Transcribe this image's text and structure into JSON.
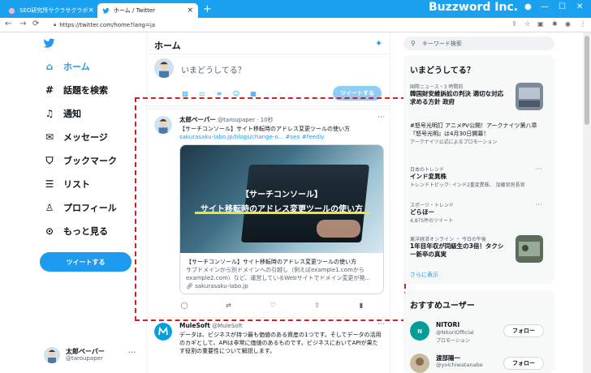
{
  "browser": {
    "tabs": [
      {
        "label": "SEO研究所サクラサクラボ",
        "active": false
      },
      {
        "label": "ホーム / Twitter",
        "active": true
      }
    ],
    "new_tab": "+",
    "brand": "Buzzword Inc.",
    "url": "https://twitter.com/home?lang=ja",
    "window_controls": [
      "—",
      "☐",
      "✕"
    ]
  },
  "sidebar": {
    "items": [
      {
        "label": "ホーム",
        "icon": "home-icon",
        "active": true
      },
      {
        "label": "話題を検索",
        "icon": "hashtag-icon",
        "active": false
      },
      {
        "label": "通知",
        "icon": "bell-icon",
        "active": false
      },
      {
        "label": "メッセージ",
        "icon": "mail-icon",
        "active": false
      },
      {
        "label": "ブックマーク",
        "icon": "bookmark-icon",
        "active": false
      },
      {
        "label": "リスト",
        "icon": "list-icon",
        "active": false
      },
      {
        "label": "プロフィール",
        "icon": "person-icon",
        "active": false
      },
      {
        "label": "もっと見る",
        "icon": "more-circle-icon",
        "active": false
      }
    ],
    "tweet_button": "ツイートする",
    "account": {
      "name": "太郎ペーパー",
      "handle": "@taroupaper",
      "more": "···"
    }
  },
  "main": {
    "title": "ホーム",
    "compose": {
      "placeholder": "いまどうしてる？",
      "button": "ツイートする"
    },
    "tweets": [
      {
        "name": "太郎ペーパー",
        "handle": "@taroupaper",
        "time": "10秒",
        "text": "【サーチコンソール】サイト移転時のアドレス変更ツールの使い方",
        "link": "sakurasaku-labo.jp/blogs/change-o...",
        "hashtags": "#seo #feedly",
        "card": {
          "title_line1": "【サーチコンソール】",
          "title_line2": "サイト移転時のアドレス変更ツールの使い方",
          "desc_title": "【サーチコンソール】サイト移転時のアドレス変更ツールの使い方",
          "desc_body": "サブドメインから別ドメインへの引越し（例えばexample1.comからexample2.com）など、運営しているWebサイトでドメイン変更が発...",
          "domain": "sakurasaku-labo.jp"
        }
      },
      {
        "name": "MuleSoft",
        "handle": "@MuleSoft",
        "text": "データは、ビジネスが持つ最も価値のある資産の1つです。そしてデータの活用のカギとして、APIは非常に価値のあるものです。ビジネスにおいてAPIが果たす役割の重要性について解説します。"
      }
    ]
  },
  "right": {
    "search_placeholder": "キーワード検索",
    "trends_title": "いまどうしてる？",
    "trends": [
      {
        "category": "国際ニュース・3 時間前",
        "name": "韓国財安維訴訟の判決 適切な対応求める方針 政府",
        "sub": "",
        "has_thumb": true
      },
      {
        "category": "",
        "name": "#怒号光明訂 アニメPV公開！アークナイツ第八章『怒号光明』は4月30日開幕！",
        "sub": "アークナイツ公式によるプロモーション",
        "has_thumb": false
      },
      {
        "category": "日本のトレンド",
        "name": "インド変異株",
        "sub": "トレンドトピック: インド2重変異株、 加藤官房長官",
        "has_thumb": false
      },
      {
        "category": "スポーツ・トレンド",
        "name": "どらほー",
        "sub": "4,875件のツイート",
        "has_thumb": false
      },
      {
        "category": "東洋経済オンライン ・ 今日の午後",
        "name": "1年目年収が同級生の3倍！タクシー新卒の真実",
        "sub": "",
        "has_thumb": true
      }
    ],
    "show_more": "さらに表示",
    "follow_title": "おすすめユーザー",
    "follows": [
      {
        "name": "NITORI",
        "handle": "@NitoriOfficial",
        "promo": "プロモーション",
        "button": "フォロー"
      },
      {
        "name": "渡部陽一",
        "handle": "@yoichiwatanabe",
        "promo": "",
        "button": "フォロー"
      }
    ]
  },
  "colors": {
    "accent": "#1d9bf0",
    "tabstrip": "#1aa1f0",
    "highlight": "#d21f1f"
  }
}
